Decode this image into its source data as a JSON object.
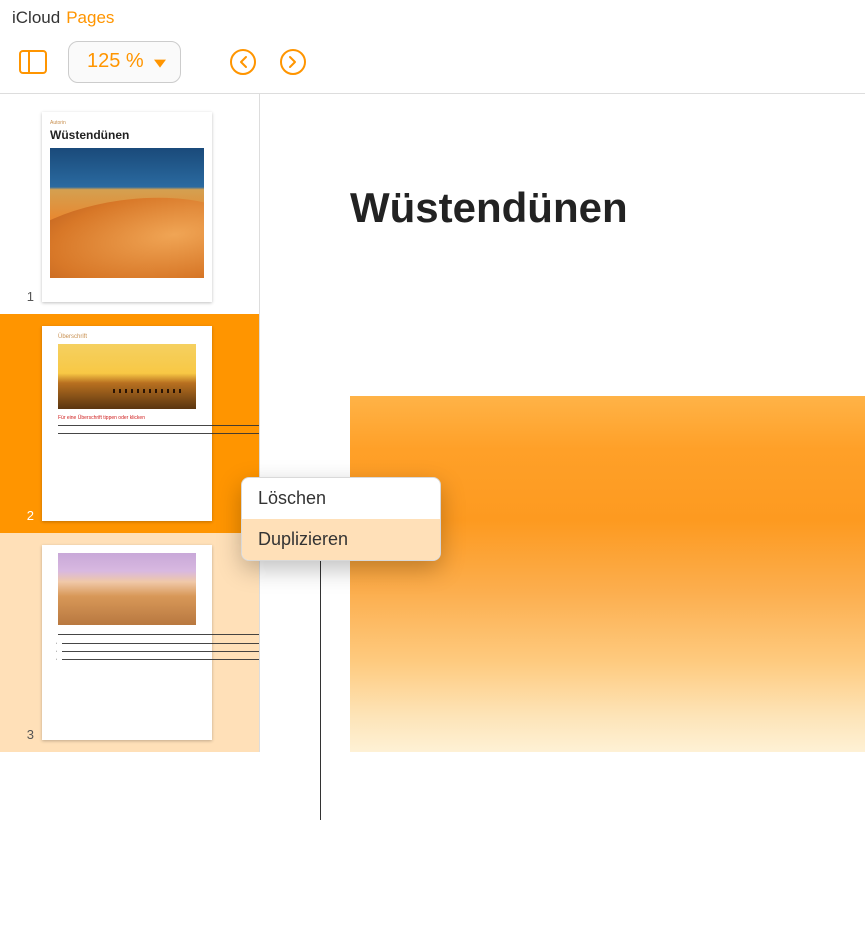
{
  "header": {
    "icloud_label": "iCloud",
    "pages_label": "Pages"
  },
  "toolbar": {
    "zoom_value": "125 %"
  },
  "thumbnails": [
    {
      "number": "1",
      "pretitle": "Autorin",
      "title": "Wüstendünen"
    },
    {
      "number": "2",
      "subheading": "Überschrift",
      "subtitle_red": "Für eine Überschrift tippen oder klicken"
    },
    {
      "number": "3"
    }
  ],
  "document": {
    "title": "Wüstendünen"
  },
  "context_menu": {
    "delete_label": "Löschen",
    "duplicate_label": "Duplizieren"
  }
}
